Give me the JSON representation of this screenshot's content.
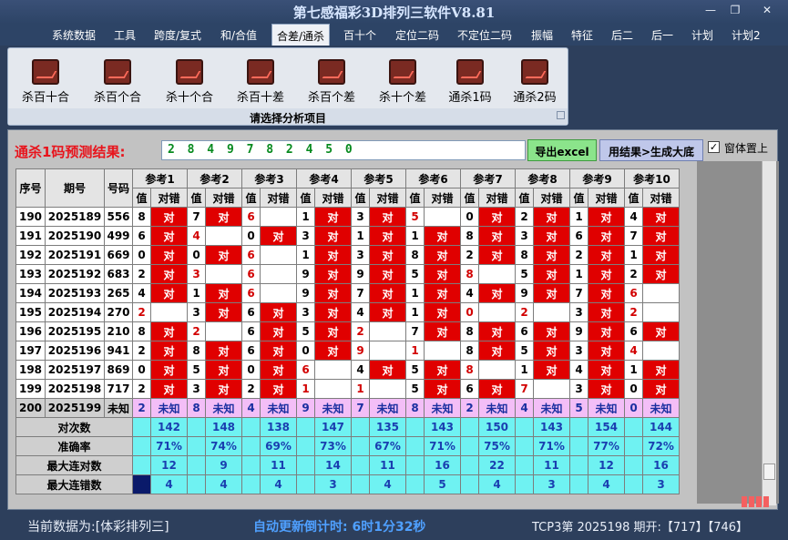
{
  "window": {
    "title": "第七感福彩3D排列三软件V8.81",
    "minimize": "—",
    "maximize": "❐",
    "close": "✕"
  },
  "menu": [
    "系统数据",
    "工具",
    "跨度/复式",
    "和/合值",
    "合差/通杀",
    "百十个",
    "定位二码",
    "不定位二码",
    "振幅",
    "特征",
    "后二",
    "后一",
    "计划",
    "计划2"
  ],
  "ribbon": {
    "tools": [
      {
        "label": "杀百十合",
        "icon": "chart-icon"
      },
      {
        "label": "杀百个合",
        "icon": "chart-icon"
      },
      {
        "label": "杀十个合",
        "icon": "chart-icon"
      },
      {
        "label": "杀百十差",
        "icon": "chart-icon"
      },
      {
        "label": "杀百个差",
        "icon": "chart-icon"
      },
      {
        "label": "杀十个差",
        "icon": "chart-icon"
      },
      {
        "label": "通杀1码",
        "icon": "chart-icon"
      },
      {
        "label": "通杀2码",
        "icon": "chart-icon"
      }
    ],
    "footer": "请选择分析项目"
  },
  "prediction": {
    "label": "通杀1码预测结果:",
    "value": "2 8 4 9 7 8 2 4 5 0",
    "excel_button": "导出excel",
    "generate_button": "用结果>生成大底",
    "ontop_label": "窗体置上",
    "ontop_checked": "✓"
  },
  "table": {
    "head": {
      "seq": "序号",
      "period": "期号",
      "number": "号码",
      "refs": [
        "参考1",
        "参考2",
        "参考3",
        "参考4",
        "参考5",
        "参考6",
        "参考7",
        "参考8",
        "参考9",
        "参考10"
      ],
      "val": "值",
      "hit": "对错"
    },
    "rows": [
      {
        "seq": "190",
        "period": "2025189",
        "num": "556",
        "vals": [
          "8",
          "7",
          "6",
          "1",
          "3",
          "5",
          "0",
          "2",
          "1",
          "4"
        ]
      },
      {
        "seq": "191",
        "period": "2025190",
        "num": "499",
        "vals": [
          "6",
          "4",
          "0",
          "3",
          "1",
          "1",
          "8",
          "3",
          "6",
          "7"
        ]
      },
      {
        "seq": "192",
        "period": "2025191",
        "num": "669",
        "vals": [
          "0",
          "0",
          "6",
          "1",
          "3",
          "8",
          "2",
          "8",
          "2",
          "1"
        ]
      },
      {
        "seq": "193",
        "period": "2025192",
        "num": "683",
        "vals": [
          "2",
          "3",
          "6",
          "9",
          "9",
          "5",
          "8",
          "5",
          "1",
          "2"
        ]
      },
      {
        "seq": "194",
        "period": "2025193",
        "num": "265",
        "vals": [
          "4",
          "1",
          "6",
          "9",
          "7",
          "1",
          "4",
          "9",
          "7",
          "6"
        ]
      },
      {
        "seq": "195",
        "period": "2025194",
        "num": "270",
        "vals": [
          "2",
          "3",
          "6",
          "3",
          "4",
          "1",
          "0",
          "2",
          "3",
          "2"
        ]
      },
      {
        "seq": "196",
        "period": "2025195",
        "num": "210",
        "vals": [
          "8",
          "2",
          "6",
          "5",
          "2",
          "7",
          "8",
          "6",
          "9",
          "6"
        ]
      },
      {
        "seq": "197",
        "period": "2025196",
        "num": "941",
        "vals": [
          "2",
          "8",
          "6",
          "0",
          "9",
          "1",
          "8",
          "5",
          "3",
          "4"
        ]
      },
      {
        "seq": "198",
        "period": "2025197",
        "num": "869",
        "vals": [
          "0",
          "5",
          "0",
          "6",
          "4",
          "5",
          "8",
          "1",
          "4",
          "1"
        ]
      },
      {
        "seq": "199",
        "period": "2025198",
        "num": "717",
        "vals": [
          "2",
          "3",
          "2",
          "1",
          "1",
          "5",
          "6",
          "7",
          "3",
          "0"
        ]
      }
    ],
    "pending": {
      "seq": "200",
      "period": "2025199",
      "num": "未知",
      "vals": [
        "2",
        "8",
        "4",
        "9",
        "7",
        "8",
        "2",
        "4",
        "5",
        "0"
      ],
      "hit": "未知"
    },
    "hit_mark": "对",
    "stats": [
      {
        "label": "对次数",
        "values": [
          "142",
          "148",
          "138",
          "147",
          "135",
          "143",
          "150",
          "143",
          "154",
          "144"
        ]
      },
      {
        "label": "准确率",
        "values": [
          "71%",
          "74%",
          "69%",
          "73%",
          "67%",
          "71%",
          "75%",
          "71%",
          "77%",
          "72%"
        ]
      },
      {
        "label": "最大连对数",
        "values": [
          "12",
          "9",
          "11",
          "14",
          "11",
          "16",
          "22",
          "11",
          "12",
          "16"
        ]
      },
      {
        "label": "最大连错数",
        "values": [
          "4",
          "4",
          "4",
          "3",
          "4",
          "5",
          "4",
          "3",
          "4",
          "3"
        ]
      }
    ]
  },
  "status": {
    "source": "当前数据为:[体彩排列三]",
    "countdown": "自动更新倒计时:  6时1分32秒",
    "latest": "TCP3第 2025198 期开:【717】【746】"
  },
  "colors": {
    "hit_red": "#e00000",
    "miss_red": "#d20000",
    "stat_cyan": "#6ff2f2",
    "pending_pink": "#f3bef7",
    "title_blue": "#d7e6ff"
  }
}
